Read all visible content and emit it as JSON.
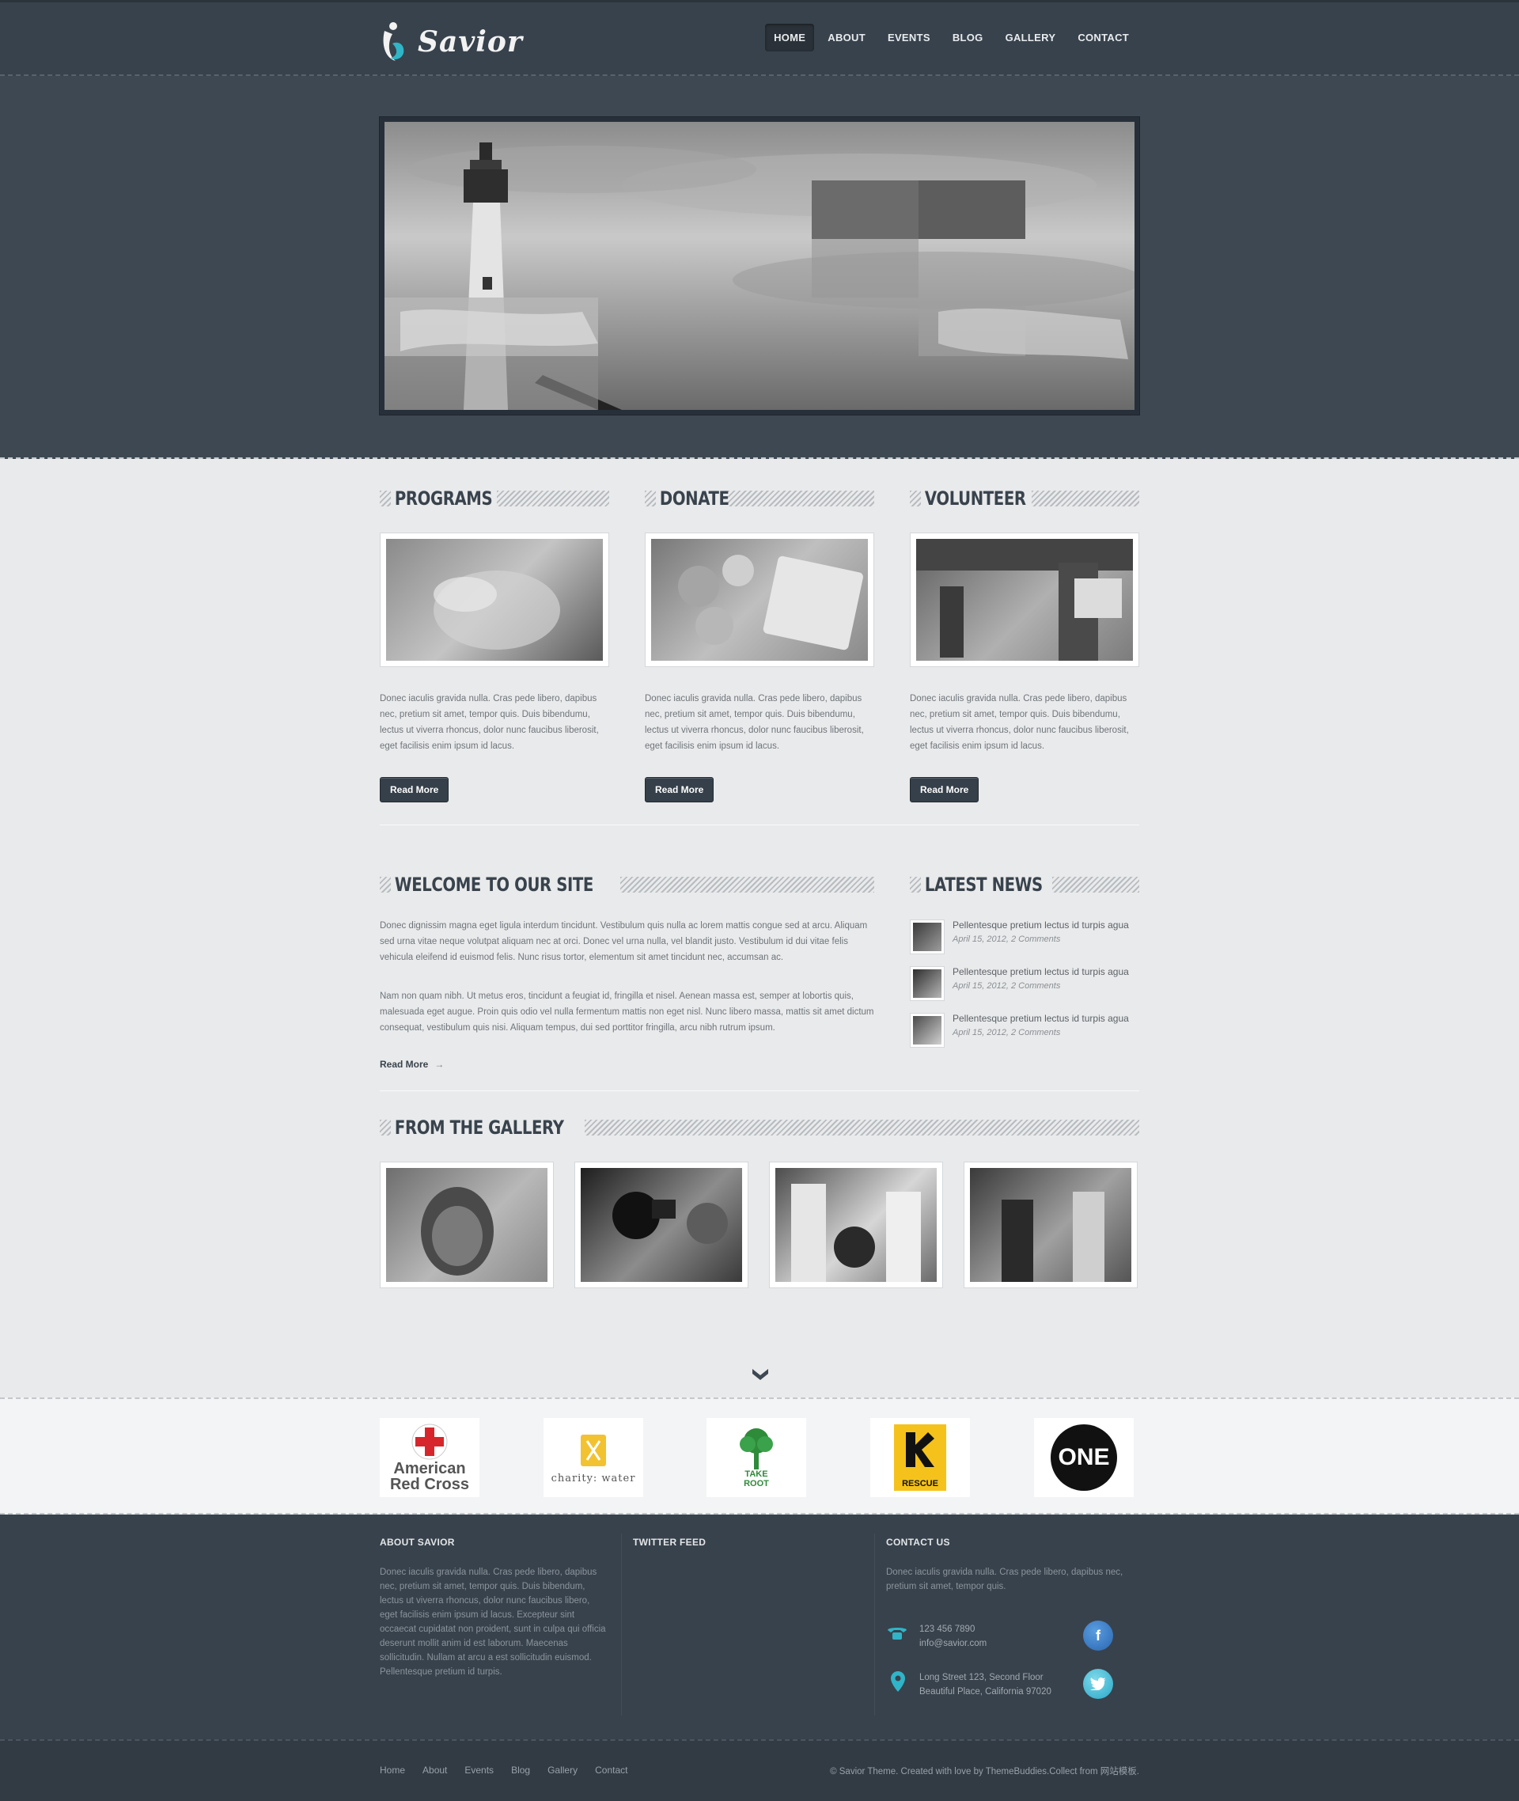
{
  "brand": {
    "name": "Savior"
  },
  "nav": {
    "items": [
      {
        "label": "HOME"
      },
      {
        "label": "ABOUT"
      },
      {
        "label": "EVENTS"
      },
      {
        "label": "BLOG"
      },
      {
        "label": "GALLERY"
      },
      {
        "label": "CONTACT"
      }
    ]
  },
  "columns": [
    {
      "title": "PROGRAMS",
      "text": "Donec iaculis gravida nulla. Cras pede libero, dapibus nec, pretium sit amet, tempor quis. Duis bibendumu, lectus ut viverra rhoncus, dolor nunc faucibus liberosit, eget facilisis enim ipsum id lacus.",
      "button": "Read More"
    },
    {
      "title": "DONATE",
      "text": "Donec iaculis gravida nulla. Cras pede libero, dapibus nec, pretium sit amet, tempor quis. Duis bibendumu, lectus ut viverra rhoncus, dolor nunc faucibus liberosit, eget facilisis enim ipsum id lacus.",
      "button": "Read More"
    },
    {
      "title": "VOLUNTEER",
      "text": "Donec iaculis gravida nulla. Cras pede libero, dapibus nec, pretium sit amet, tempor quis. Duis bibendumu, lectus ut viverra rhoncus, dolor nunc faucibus liberosit, eget facilisis enim ipsum id lacus.",
      "button": "Read More"
    }
  ],
  "welcome": {
    "title": "WELCOME TO OUR SITE",
    "p1": "Donec dignissim magna eget ligula interdum tincidunt. Vestibulum quis nulla ac lorem mattis congue sed at arcu. Aliquam sed urna vitae neque volutpat aliquam nec at orci. Donec vel urna nulla, vel blandit justo. Vestibulum id dui vitae felis vehicula eleifend id euismod felis. Nunc risus tortor, elementum sit amet tincidunt nec, accumsan ac.",
    "p2": "Nam non quam nibh. Ut metus eros, tincidunt a feugiat id, fringilla et nisel. Aenean massa est, semper at lobortis quis, malesuada eget augue. Proin quis odio vel nulla fermentum mattis non eget nisl. Nunc libero massa, mattis sit amet dictum consequat, vestibulum quis nisi. Aliquam tempus, dui sed porttitor fringilla, arcu nibh rutrum ipsum.",
    "read_more": "Read More",
    "arrow": "→"
  },
  "news": {
    "title": "LATEST NEWS",
    "items": [
      {
        "title": "Pellentesque pretium lectus id turpis agua",
        "meta": "April 15, 2012, 2 Comments"
      },
      {
        "title": "Pellentesque pretium lectus id turpis agua",
        "meta": "April 15, 2012, 2 Comments"
      },
      {
        "title": "Pellentesque pretium lectus id turpis agua",
        "meta": "April 15, 2012, 2 Comments"
      }
    ]
  },
  "gallery": {
    "title": "FROM THE GALLERY"
  },
  "partners": [
    {
      "line1": "American",
      "line2": "Red Cross"
    },
    {
      "line1": "charity: water"
    },
    {
      "line1": "TAKE",
      "line2": "ROOT"
    },
    {
      "line1": "RESCUE"
    },
    {
      "line1": "ONE"
    }
  ],
  "footer": {
    "about_title": "ABOUT SAVIOR",
    "about_text": "Donec iaculis gravida nulla. Cras pede libero, dapibus nec, pretium sit amet, tempor quis. Duis bibendum, lectus ut viverra rhoncus, dolor nunc faucibus libero, eget facilisis enim ipsum id lacus. Excepteur sint occaecat cupidatat non proident, sunt in culpa qui officia deserunt mollit anim id est laborum. Maecenas sollicitudin. Nullam at arcu a est sollicitudin euismod. Pellentesque pretium id turpis.",
    "twitter_title": "TWITTER FEED",
    "contact_title": "CONTACT US",
    "contact_text": "Donec iaculis gravida nulla. Cras pede libero, dapibus nec, pretium sit amet, tempor quis.",
    "phone": "123 456 7890",
    "email": "info@savior.com",
    "address1": "Long Street 123, Second Floor",
    "address2": "Beautiful Place, California 97020",
    "facebook": "f",
    "twitter": "t"
  },
  "bottom": {
    "links": [
      {
        "label": "Home"
      },
      {
        "label": "About"
      },
      {
        "label": "Events"
      },
      {
        "label": "Blog"
      },
      {
        "label": "Gallery"
      },
      {
        "label": "Contact"
      }
    ],
    "copyright": "© Savior Theme. Created with love by ThemeBuddies.Collect from 网站模板."
  },
  "colors": {
    "dark": "#38424c",
    "accent": "#2fb4c8",
    "light_bg": "#e9eaeb"
  }
}
